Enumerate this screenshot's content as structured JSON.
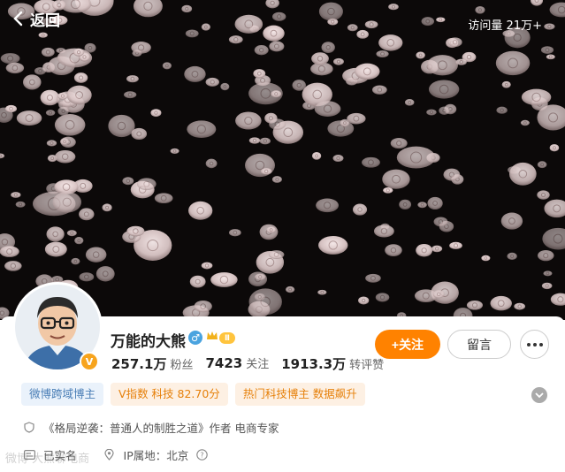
{
  "topbar": {
    "back_label": "返回",
    "visits": "访问量 21万+"
  },
  "profile": {
    "name": "万能的大熊",
    "gender_icon": "male-icon",
    "level": "Ⅱ",
    "verified_badge": "V",
    "accent_color": "#ff8200"
  },
  "stats": [
    {
      "value": "257.1万",
      "label": "粉丝"
    },
    {
      "value": "7423",
      "label": "关注"
    },
    {
      "value": "1913.3万",
      "label": "转评赞"
    }
  ],
  "actions": {
    "follow": "+关注",
    "message": "留言"
  },
  "tags": [
    {
      "text": "微博跨域博主",
      "style": "blue"
    },
    {
      "text": "V指数 科技 82.70分",
      "style": "orange"
    },
    {
      "text": "热门科技博主 数据飙升",
      "style": "orange"
    }
  ],
  "info": {
    "bio": "《格局逆袭：普通人的制胜之道》作者 电商专家",
    "realname": "已实名",
    "ip": "IP属地：北京"
  },
  "watermark": "微博 大熊聊电商"
}
